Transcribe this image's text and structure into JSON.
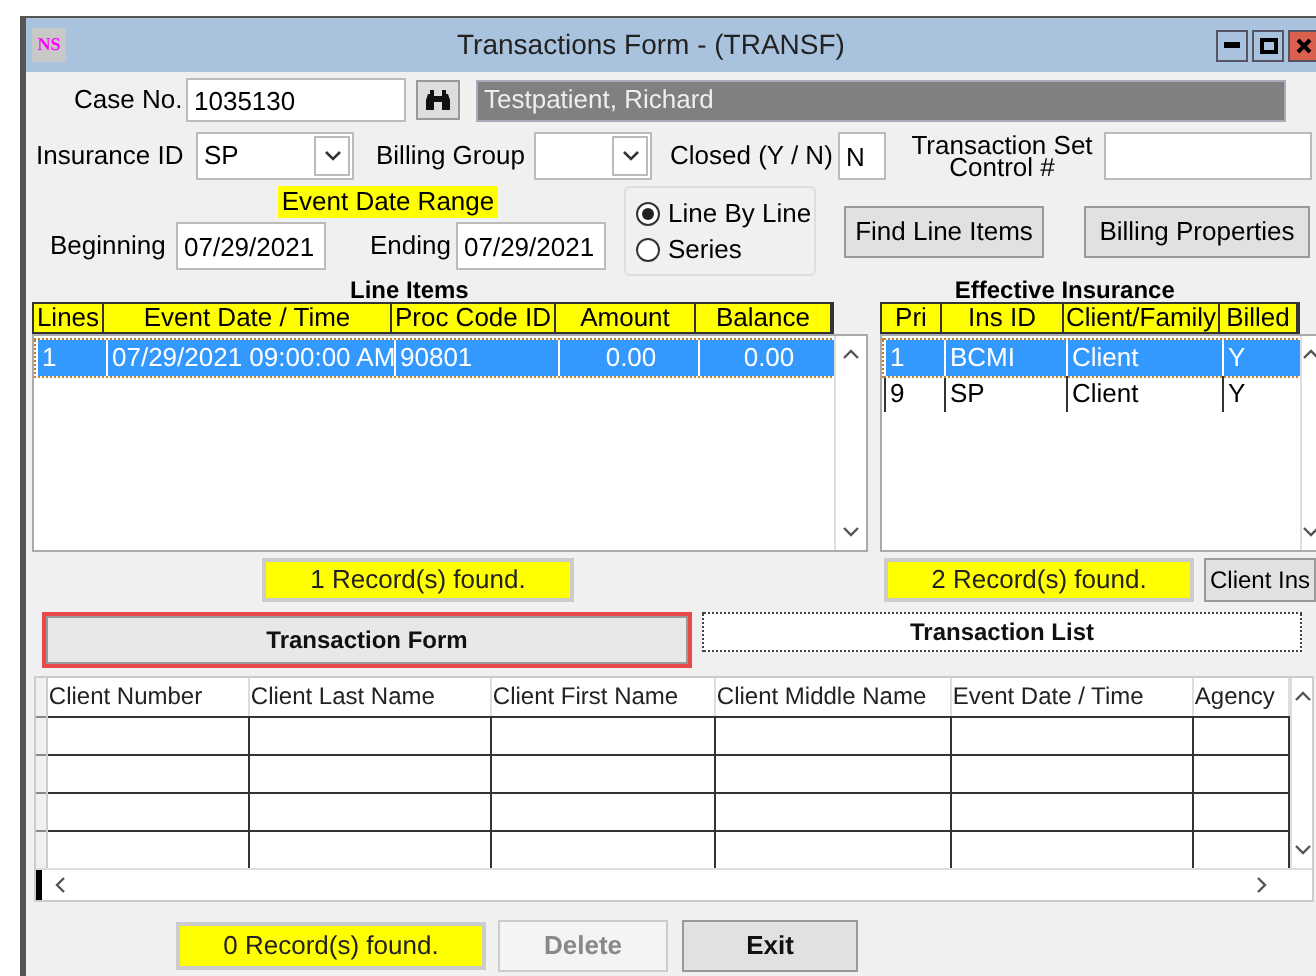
{
  "window": {
    "title": "Transactions Form - (TRANSF)",
    "logo": "NS"
  },
  "case": {
    "label": "Case No.",
    "value": "1035130",
    "client_name": "Testpatient, Richard"
  },
  "insurance_id": {
    "label": "Insurance ID",
    "value": "SP"
  },
  "billing_group": {
    "label": "Billing Group"
  },
  "closed": {
    "label": "Closed (Y / N)",
    "value": "N"
  },
  "transaction_set": {
    "label": "Transaction Set Control #"
  },
  "event_date_range": {
    "label": "Event Date Range",
    "beginning_label": "Beginning",
    "beginning": "07/29/2021",
    "ending_label": "Ending",
    "ending": "07/29/2021"
  },
  "mode_options": [
    {
      "label": "Line By Line",
      "selected": true
    },
    {
      "label": "Series",
      "selected": false
    }
  ],
  "action_buttons": [
    {
      "label": "Find Line Items"
    },
    {
      "label": "Billing Properties"
    }
  ],
  "line_items": {
    "title": "Line Items",
    "columns": [
      "Lines",
      "Event Date / Time",
      "Proc Code ID",
      "Amount",
      "Balance"
    ],
    "rows": [
      {
        "cells": [
          "1",
          "07/29/2021 09:00:00 AM",
          "90801",
          "0.00",
          "0.00"
        ],
        "selected": true
      }
    ],
    "status": "1 Record(s) found."
  },
  "effective_insurance": {
    "title": "Effective Insurance",
    "columns": [
      "Pri",
      "Ins ID",
      "Client/Family",
      "Billed"
    ],
    "rows": [
      {
        "cells": [
          "1",
          "BCMI",
          "Client",
          "Y"
        ],
        "selected": true
      },
      {
        "cells": [
          "9",
          "SP",
          "Client",
          "Y"
        ],
        "selected": false
      }
    ],
    "status": "2 Record(s) found.",
    "side_button": "Client Ins"
  },
  "tabs": [
    {
      "label": "Transaction Form",
      "selected": true
    },
    {
      "label": "Transaction List",
      "selected": false
    }
  ],
  "transactions": {
    "columns": [
      "Client Number",
      "Client Last Name",
      "Client First Name",
      "Client Middle Name",
      "Event Date / Time",
      "Agency"
    ],
    "status": "0 Record(s) found."
  },
  "footer_buttons": [
    {
      "label": "Delete",
      "disabled": true
    },
    {
      "label": "Exit",
      "disabled": false
    }
  ]
}
